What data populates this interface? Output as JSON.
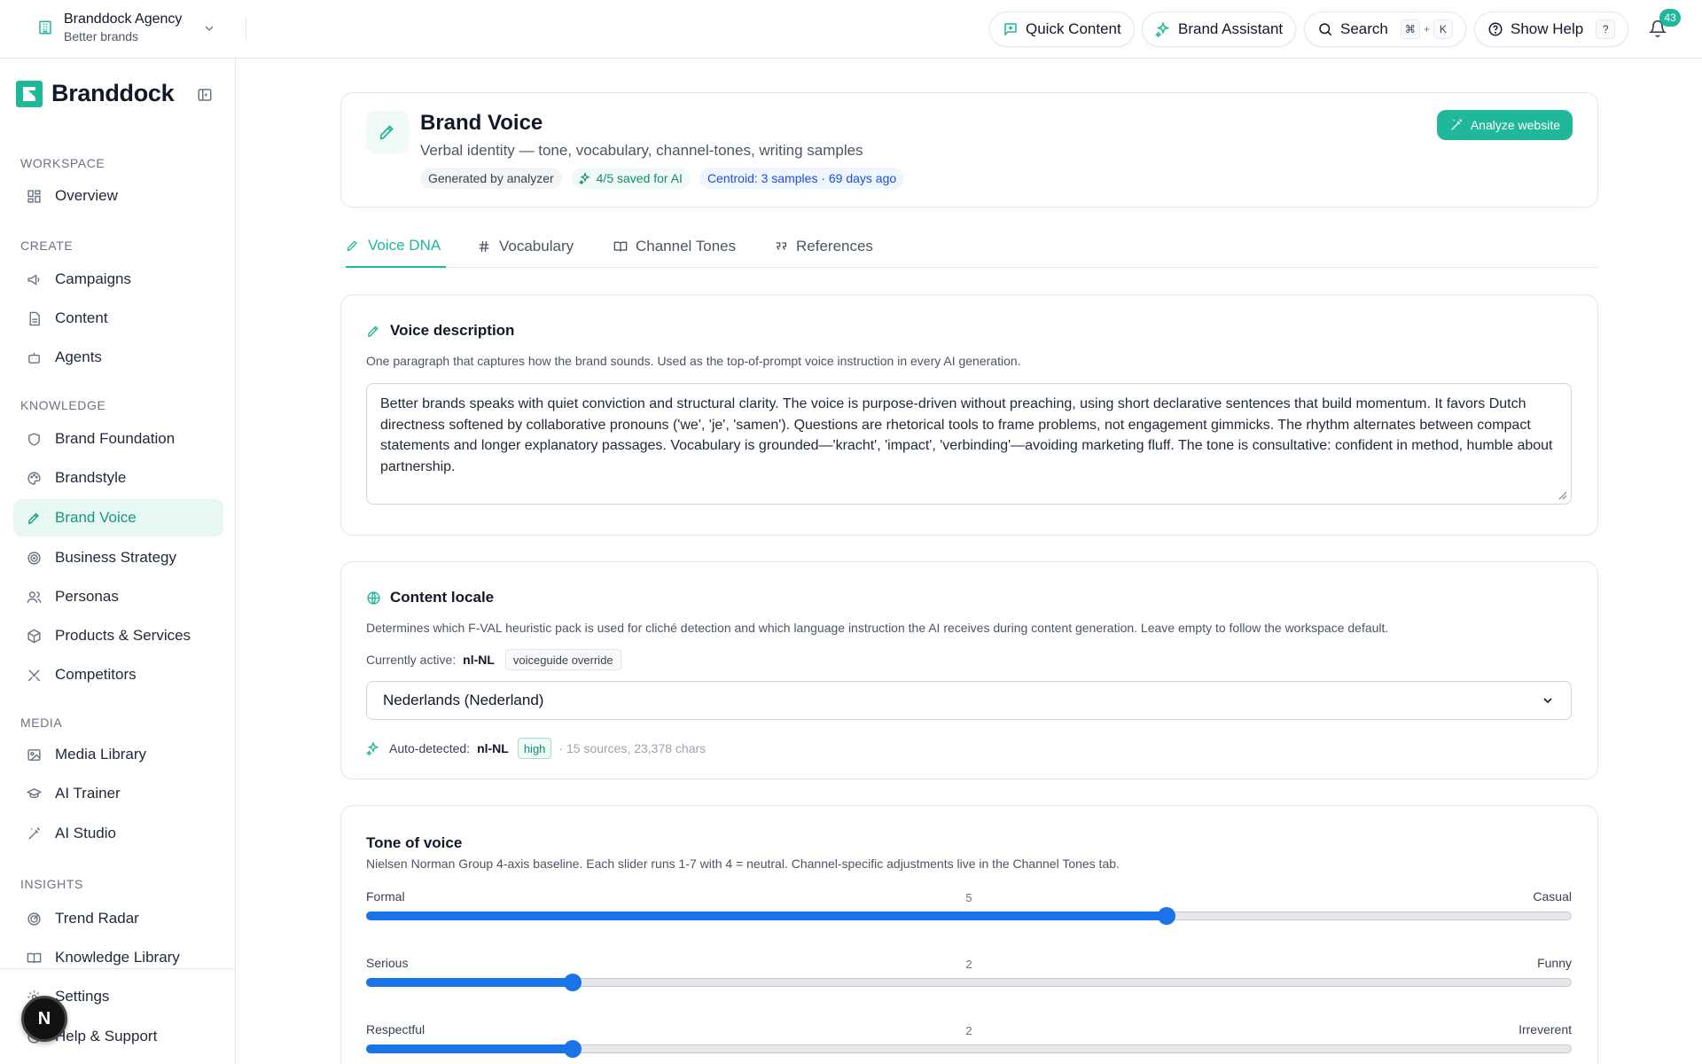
{
  "topbar": {
    "workspace_name": "Branddock Agency",
    "workspace_sub": "Better brands",
    "quick_content": "Quick Content",
    "brand_assistant": "Brand Assistant",
    "search": "Search",
    "search_kbd1": "⌘",
    "search_plus": "+",
    "search_kbd2": "K",
    "show_help": "Show Help",
    "help_kbd": "?",
    "notifications": "43"
  },
  "sidebar": {
    "logo": "Branddock",
    "sections": {
      "workspace": "WORKSPACE",
      "create": "CREATE",
      "knowledge": "KNOWLEDGE",
      "media": "MEDIA",
      "insights": "INSIGHTS"
    },
    "items": {
      "overview": "Overview",
      "campaigns": "Campaigns",
      "content": "Content",
      "agents": "Agents",
      "brand_foundation": "Brand Foundation",
      "brandstyle": "Brandstyle",
      "brand_voice": "Brand Voice",
      "business_strategy": "Business Strategy",
      "personas": "Personas",
      "products": "Products & Services",
      "competitors": "Competitors",
      "media_library": "Media Library",
      "ai_trainer": "AI Trainer",
      "ai_studio": "AI Studio",
      "trend_radar": "Trend Radar",
      "knowledge_library": "Knowledge Library",
      "settings": "Settings",
      "help": "Help & Support"
    },
    "avatar": "N"
  },
  "header": {
    "title": "Brand Voice",
    "subtitle": "Verbal identity — tone, vocabulary, channel-tones, writing samples",
    "chip_generated": "Generated by analyzer",
    "chip_saved": "4/5 saved for AI",
    "chip_centroid": "Centroid: 3 samples · 69 days ago",
    "analyze_button": "Analyze website"
  },
  "tabs": {
    "voice_dna": "Voice DNA",
    "vocabulary": "Vocabulary",
    "channel_tones": "Channel Tones",
    "references": "References"
  },
  "voice_description": {
    "title": "Voice description",
    "description": "One paragraph that captures how the brand sounds. Used as the top-of-prompt voice instruction in every AI generation.",
    "value": "Better brands speaks with quiet conviction and structural clarity. The voice is purpose-driven without preaching, using short declarative sentences that build momentum. It favors Dutch directness softened by collaborative pronouns ('we', 'je', 'samen'). Questions are rhetorical tools to frame problems, not engagement gimmicks. The rhythm alternates between compact statements and longer explanatory passages. Vocabulary is grounded—'kracht', 'impact', 'verbinding'—avoiding marketing fluff. The tone is consultative: confident in method, humble about partnership."
  },
  "content_locale": {
    "title": "Content locale",
    "description": "Determines which F-VAL heuristic pack is used for cliché detection and which language instruction the AI receives during content generation. Leave empty to follow the workspace default.",
    "currently_active_label": "Currently active:",
    "currently_active_value": "nl-NL",
    "override_badge": "voiceguide override",
    "selected": "Nederlands (Nederland)",
    "auto_label": "Auto-detected:",
    "auto_value": "nl-NL",
    "confidence": "high",
    "sources": "· 15 sources, 23,378 chars"
  },
  "tone": {
    "title": "Tone of voice",
    "description": "Nielsen Norman Group 4-axis baseline. Each slider runs 1-7 with 4 = neutral. Channel-specific adjustments live in the Channel Tones tab.",
    "sliders": [
      {
        "left": "Formal",
        "right": "Casual",
        "value": 5,
        "min": 1,
        "max": 7
      },
      {
        "left": "Serious",
        "right": "Funny",
        "value": 2,
        "min": 1,
        "max": 7
      },
      {
        "left": "Respectful",
        "right": "Irreverent",
        "value": 2,
        "min": 1,
        "max": 7
      }
    ]
  },
  "colors": {
    "accent": "#1fb89a",
    "slider": "#1a73e8"
  }
}
